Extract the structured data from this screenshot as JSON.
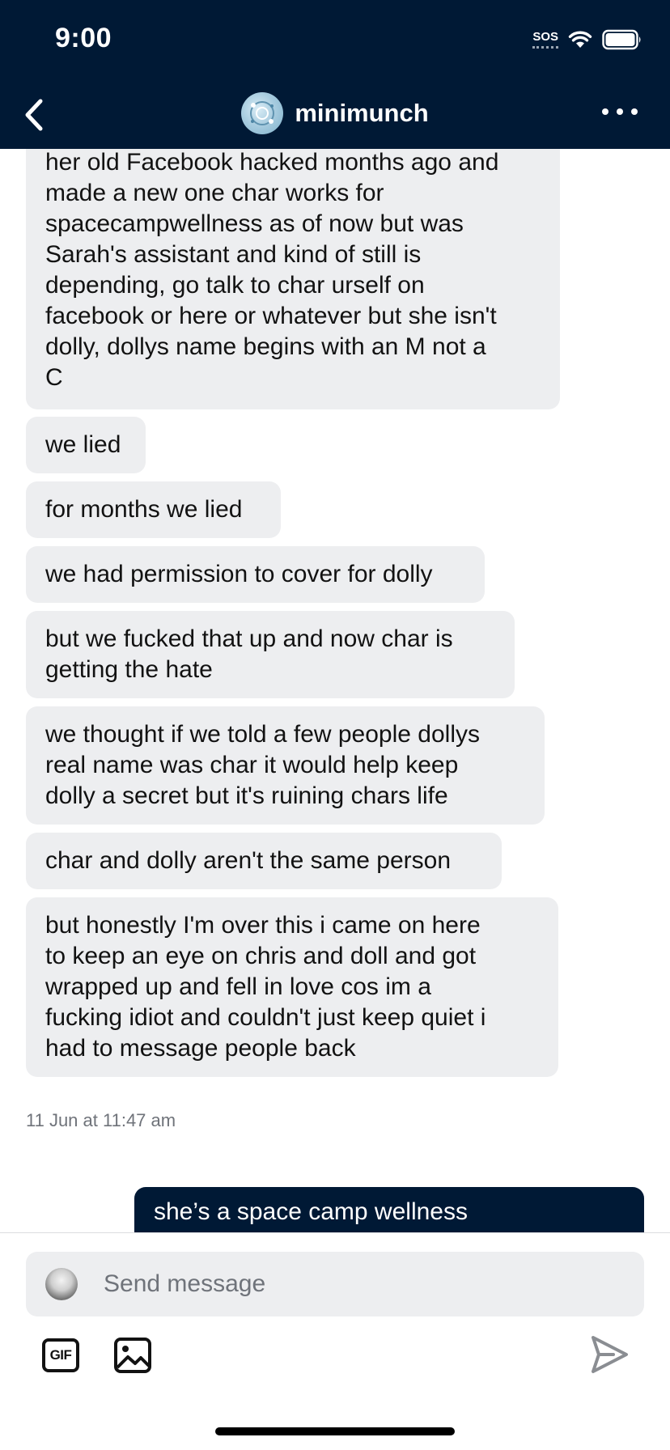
{
  "status_bar": {
    "time": "9:00",
    "sos": "SOS"
  },
  "header": {
    "back_icon": "chevron-left-icon",
    "username": "minimunch",
    "more_icon": "more-horizontal-icon"
  },
  "messages": [
    {
      "text": "her old Facebook hacked months ago and\nmade a new one char works for\nspacecampwellness as of now but was\nSarah's assistant and kind of still is\ndepending, go talk to char urself on\nfacebook or here or whatever but she isn't\ndolly, dollys name begins with an M not a\nC"
    },
    {
      "text": "we lied"
    },
    {
      "text": "for months we lied"
    },
    {
      "text": "we had permission to cover for dolly"
    },
    {
      "text": "but we fucked that up and now char is\ngetting the hate"
    },
    {
      "text": "we thought if we told a few people dollys\nreal name was char it would help keep\ndolly a secret but it's ruining chars life"
    },
    {
      "text": "char and dolly aren't the same person"
    },
    {
      "text": "but honestly I'm over this i came on here\nto keep an eye on chris and doll and got\nwrapped up and fell in love cos im a\nfucking idiot and couldn't just keep quiet i\nhad to message people back"
    }
  ],
  "timestamp": "11 Jun at 11:47 am",
  "sent_message": "she’s a space camp wellness",
  "composer": {
    "placeholder": "Send message",
    "gif_label": "GIF",
    "image_icon": "image-icon",
    "send_icon": "send-icon"
  },
  "colors": {
    "header_bg": "#001935",
    "received_bubble": "#edeef0",
    "sent_bubble": "#001935",
    "text": "#121212",
    "muted": "#6f737a"
  }
}
